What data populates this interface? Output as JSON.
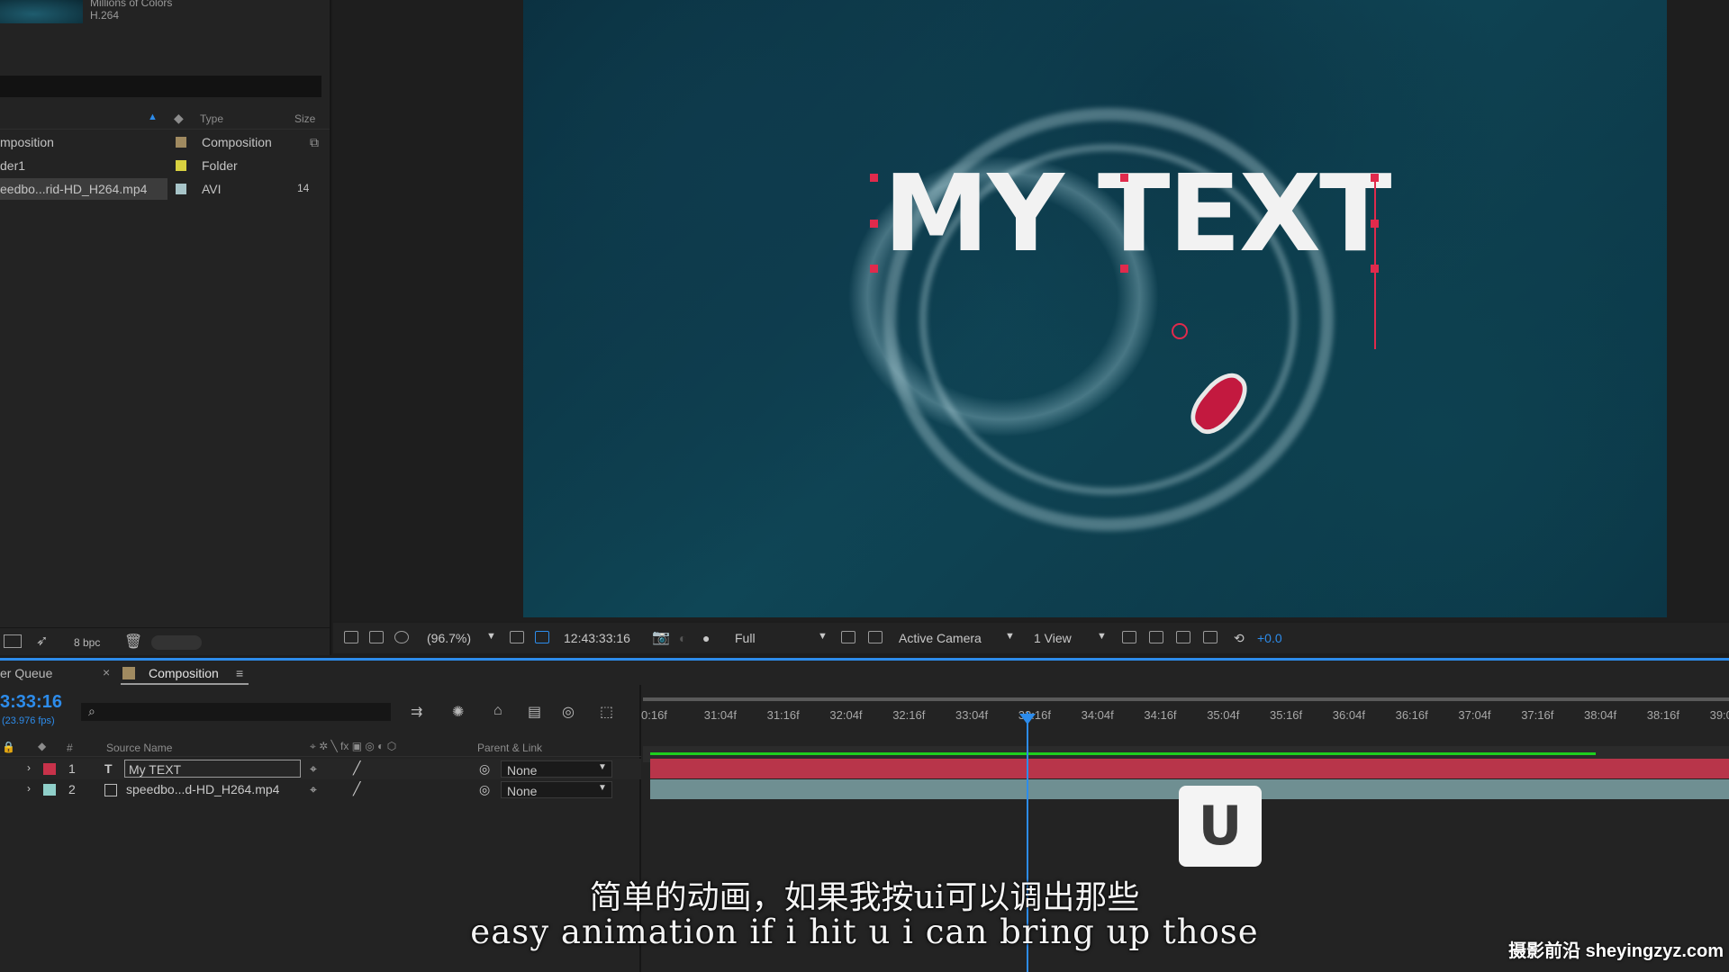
{
  "project": {
    "footage_meta": [
      "Millions of Colors",
      "H.264"
    ],
    "columns": {
      "type": "Type",
      "size": "Size"
    },
    "items": [
      {
        "name": "mposition",
        "type": "Composition",
        "color": "#a08a60",
        "size": ""
      },
      {
        "name": "der1",
        "type": "Folder",
        "color": "#d8d140",
        "size": ""
      },
      {
        "name": "eedbo...rid-HD_H264.mp4",
        "type": "AVI",
        "color": "#a7c4c8",
        "size": "14"
      }
    ],
    "bpc": "8 bpc"
  },
  "viewer": {
    "overlay_text": "MY TEXT",
    "zoom": "(96.7%)",
    "timecode": "12:43:33:16",
    "resolution": "Full",
    "camera": "Active Camera",
    "views": "1 View",
    "exposure": "+0.0"
  },
  "tabs": {
    "render_queue": "er Queue",
    "composition": "Composition"
  },
  "timeline": {
    "current_time": "3:33:16",
    "fps": "(23.976 fps)",
    "headers": {
      "number": "#",
      "source_name": "Source Name",
      "parent": "Parent & Link"
    },
    "layers": [
      {
        "index": "1",
        "name": "My TEXT",
        "type": "T",
        "label_color": "#c8324a",
        "parent": "None"
      },
      {
        "index": "2",
        "name": "speedbo...d-HD_H264.mp4",
        "type": "file",
        "label_color": "#8fcfc9",
        "parent": "None"
      }
    ],
    "ruler_ticks": [
      "0:16f",
      "31:04f",
      "31:16f",
      "32:04f",
      "32:16f",
      "33:04f",
      "33:16f",
      "34:04f",
      "34:16f",
      "35:04f",
      "35:16f",
      "36:04f",
      "36:16f",
      "37:04f",
      "37:16f",
      "38:04f",
      "38:16f",
      "39:0"
    ]
  },
  "overlay": {
    "key": "U",
    "subtitle_cn": "简单的动画，如果我按ui可以调出那些",
    "subtitle_en": "easy animation if i hit u i can bring up those",
    "watermark": "摄影前沿 sheyingzyz.com"
  }
}
